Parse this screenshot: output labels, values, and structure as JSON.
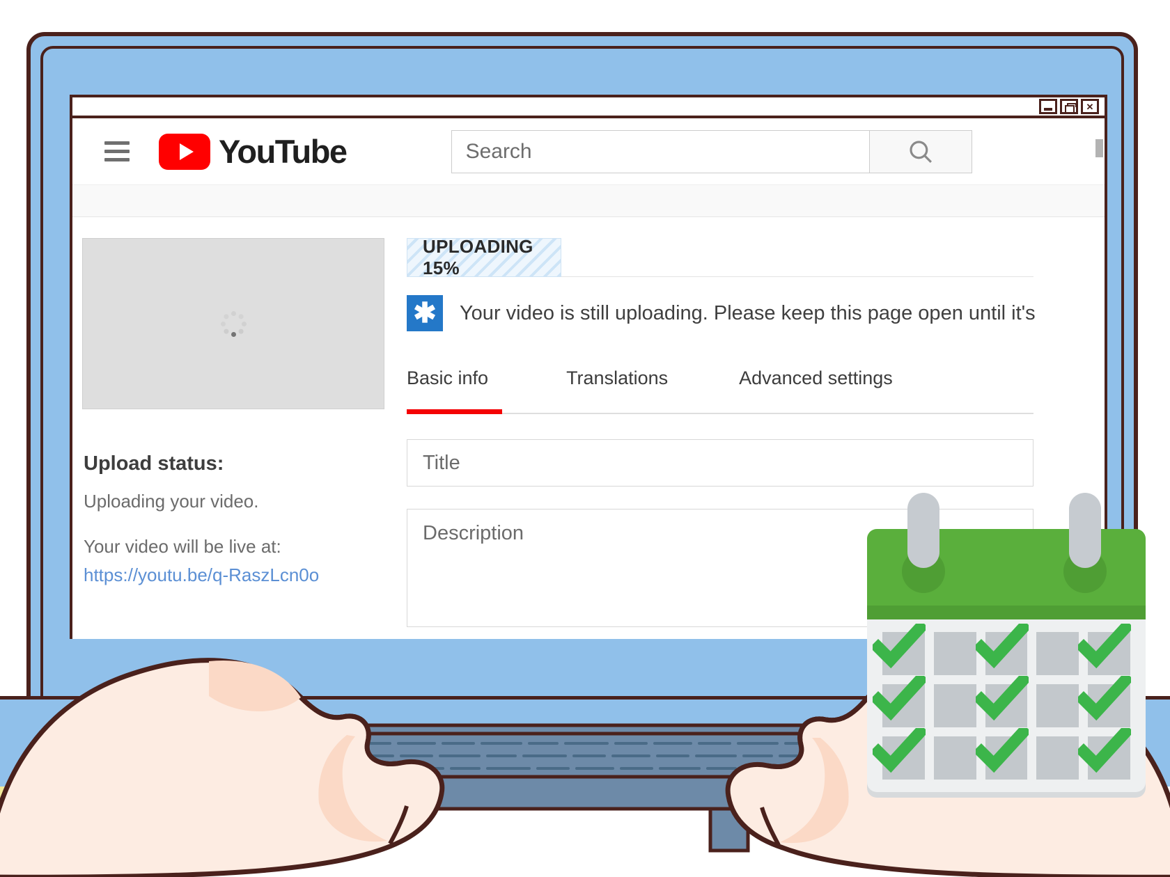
{
  "window": {
    "controls": [
      {
        "name": "minimize",
        "glyph": "_"
      },
      {
        "name": "maximize",
        "glyph": "❐"
      },
      {
        "name": "close",
        "glyph": "✕"
      }
    ]
  },
  "header": {
    "menu_icon": "hamburger-icon",
    "brand": "YouTube",
    "logo_icon": "youtube-play-icon",
    "search": {
      "placeholder": "Search",
      "value": "",
      "button_icon": "search-icon"
    }
  },
  "upload": {
    "progress_label": "UPLOADING 15%",
    "progress_percent": 15,
    "banner_icon": "asterisk-icon",
    "banner_text": "Your video is still uploading. Please keep this page open until it's",
    "thumbnail_spinner_icon": "loading-spinner-icon"
  },
  "sidebar": {
    "status_title": "Upload status:",
    "status_line": "Uploading your video.",
    "live_at_label": "Your video will be live at:",
    "live_url": "https://youtu.be/q-RaszLcn0o"
  },
  "tabs": [
    {
      "label": "Basic info",
      "active": true
    },
    {
      "label": "Translations",
      "active": false
    },
    {
      "label": "Advanced settings",
      "active": false
    }
  ],
  "form": {
    "title_placeholder": "Title",
    "title_value": "",
    "description_placeholder": "Description",
    "description_value": ""
  },
  "colors": {
    "youtube_red": "#ff0000",
    "tab_accent": "#f40204",
    "banner_blue": "#2478c8",
    "link_blue": "#5b8fd4",
    "laptop_blue": "#90c0ea",
    "outline_brown": "#4a211c",
    "calendar_green": "#5aaf3c",
    "check_green": "#3cb54a",
    "desk_yellow": "#f3ea9b",
    "skin": "#fce9dd"
  },
  "calendar": {
    "icon": "calendar-icon",
    "rows": 3,
    "cols": 5,
    "checked_columns": [
      1,
      3,
      5
    ]
  }
}
